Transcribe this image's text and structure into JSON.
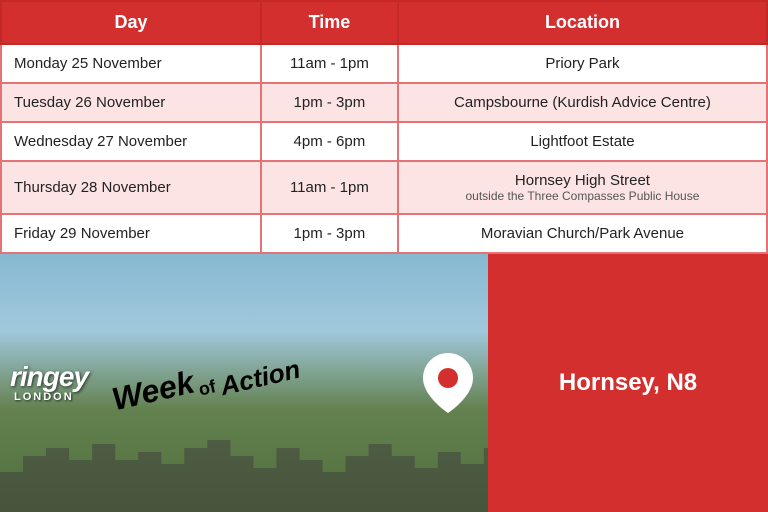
{
  "table": {
    "headers": [
      "Day",
      "Time",
      "Location"
    ],
    "rows": [
      {
        "day": "Monday 25 November",
        "time": "11am - 1pm",
        "location": "Priory Park",
        "location_sub": ""
      },
      {
        "day": "Tuesday 26 November",
        "time": "1pm - 3pm",
        "location": "Campsbourne (Kurdish Advice Centre)",
        "location_sub": ""
      },
      {
        "day": "Wednesday 27 November",
        "time": "4pm - 6pm",
        "location": "Lightfoot Estate",
        "location_sub": ""
      },
      {
        "day": "Thursday 28 November",
        "time": "11am - 1pm",
        "location": "Hornsey High Street",
        "location_sub": "outside the Three Compasses Public House"
      },
      {
        "day": "Friday 29 November",
        "time": "1pm - 3pm",
        "location": "Moravian Church/Park Avenue",
        "location_sub": ""
      }
    ]
  },
  "banner": {
    "org_name": "ringey",
    "london_label": "LONDON",
    "week_label": "Week",
    "of_label": "of",
    "action_label": "Action",
    "location_label": "Hornsey, N8"
  }
}
